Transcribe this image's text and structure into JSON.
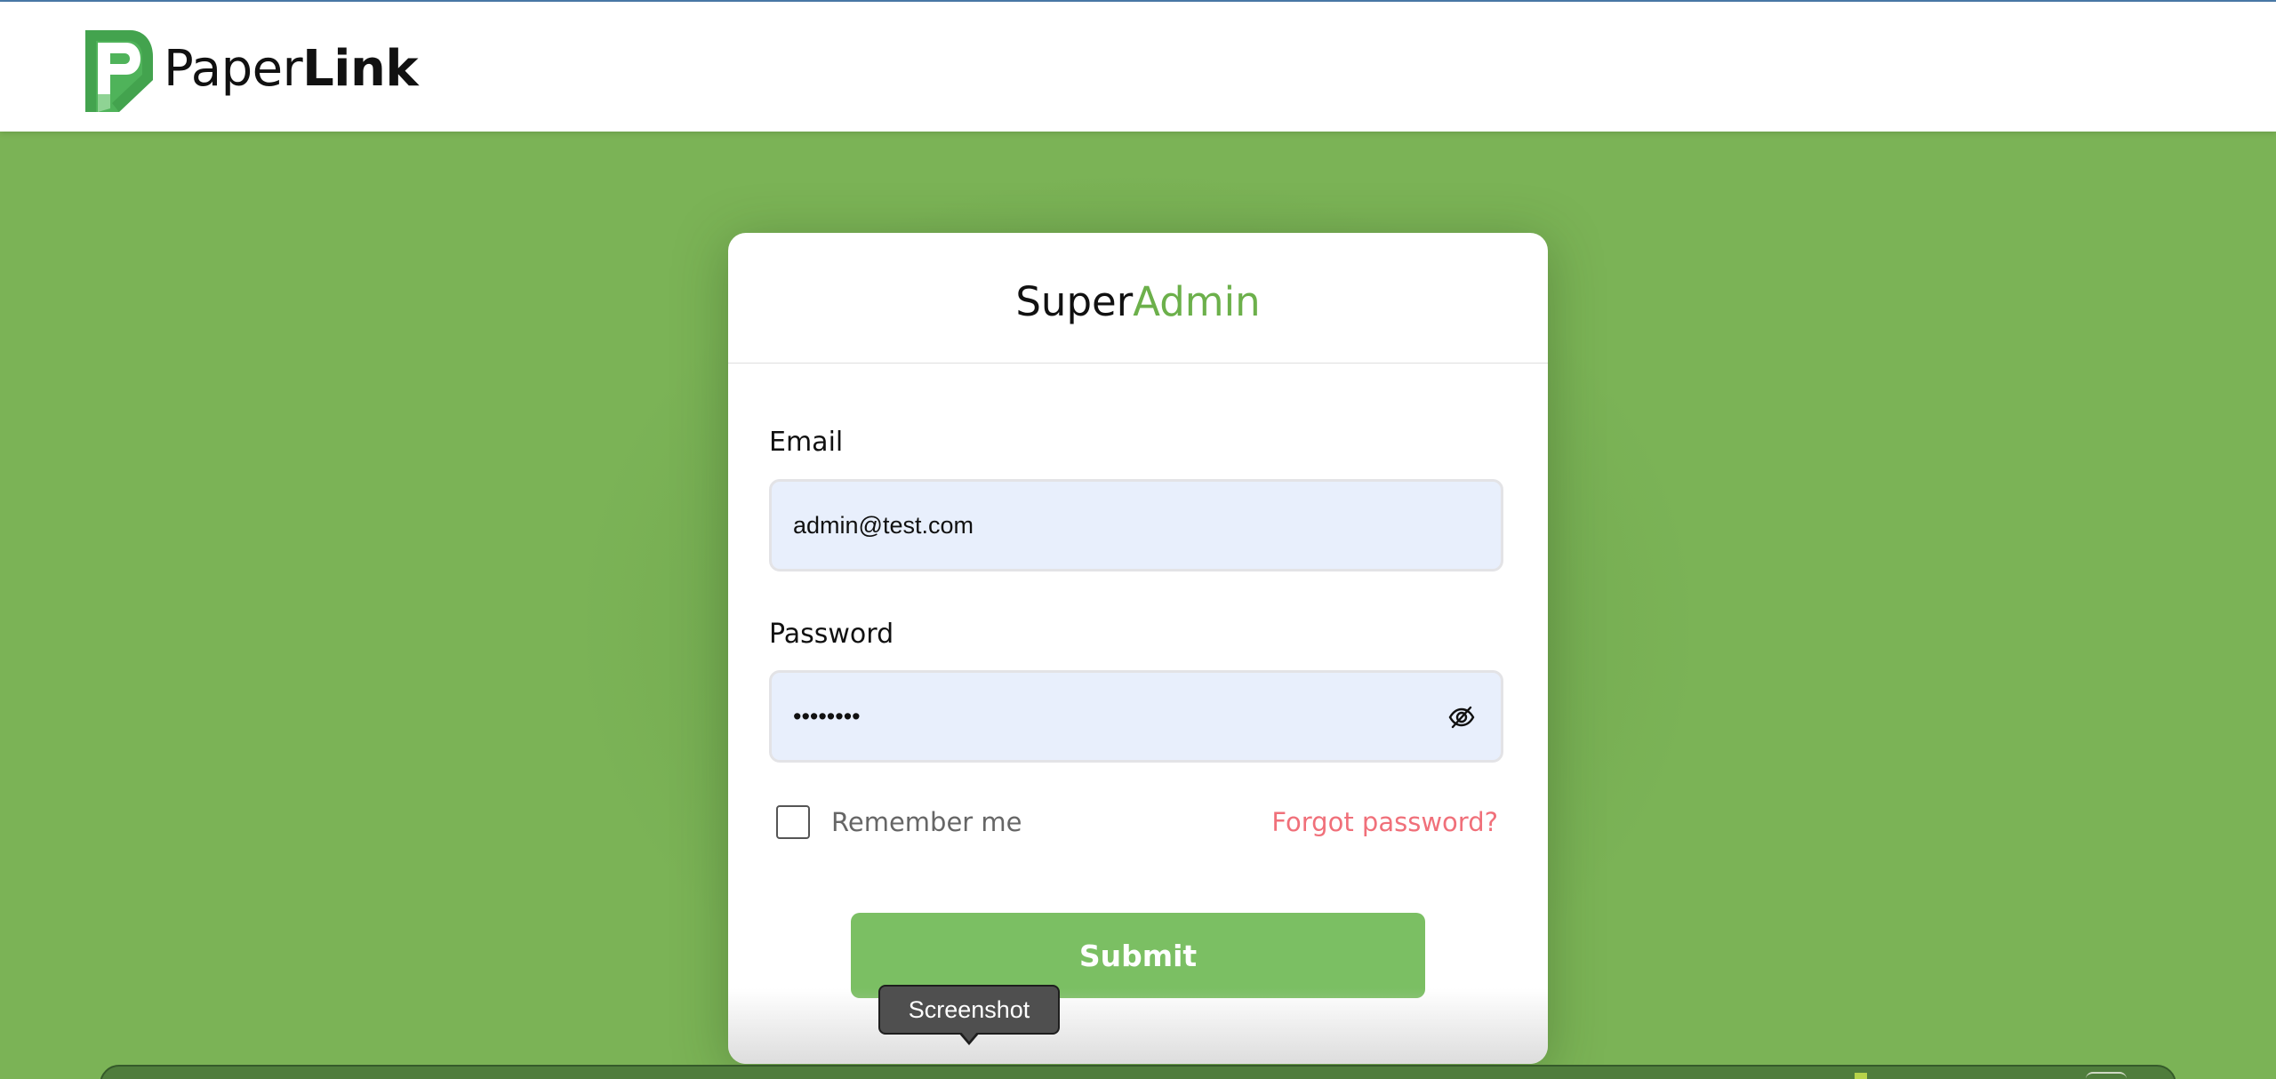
{
  "header": {
    "logo": {
      "icon": "paperlink-logo-icon",
      "name_regular": "Paper",
      "name_bold": "Link"
    }
  },
  "login": {
    "title_part1": "Super",
    "title_part2": "Admin",
    "email": {
      "label": "Email",
      "value": "admin@test.com"
    },
    "password": {
      "label": "Password",
      "value": "••••••••",
      "toggle_icon": "eye-slash-icon"
    },
    "remember_me": {
      "label": "Remember me",
      "checked": false
    },
    "forgot_password": "Forgot password?",
    "submit_label": "Submit"
  },
  "tooltip": {
    "text": "Screenshot"
  },
  "colors": {
    "background": "#7bb356",
    "accent": "#6cb04b",
    "submit": "#7bbf63",
    "forgot_link": "#f0707a",
    "field_bg": "#e8effc"
  }
}
